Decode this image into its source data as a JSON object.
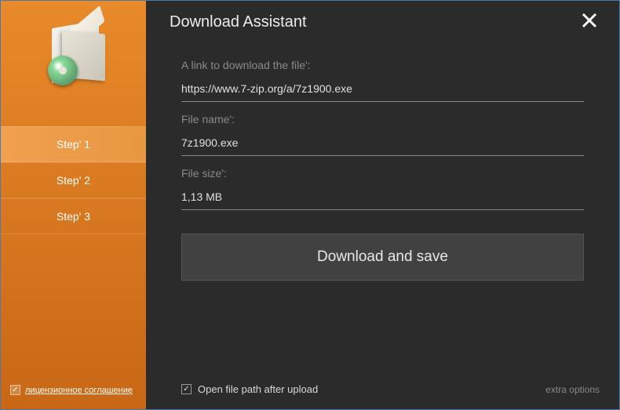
{
  "app": {
    "title": "Download Assistant"
  },
  "sidebar": {
    "steps": [
      {
        "label": "Step' 1",
        "active": true
      },
      {
        "label": "Step' 2",
        "active": false
      },
      {
        "label": "Step' 3",
        "active": false
      }
    ],
    "license": {
      "checked": true,
      "label": "лицензионное соглашение"
    }
  },
  "form": {
    "link_label": "A link to download the file':",
    "link_value": "https://www.7-zip.org/a/7z1900.exe",
    "filename_label": "File name':",
    "filename_value": "7z1900.exe",
    "filesize_label": "File size':",
    "filesize_value": "1,13 MB",
    "download_button": "Download and save"
  },
  "footer": {
    "open_path_checked": true,
    "open_path_label": "Open file path after upload",
    "extra_options": "extra options"
  }
}
